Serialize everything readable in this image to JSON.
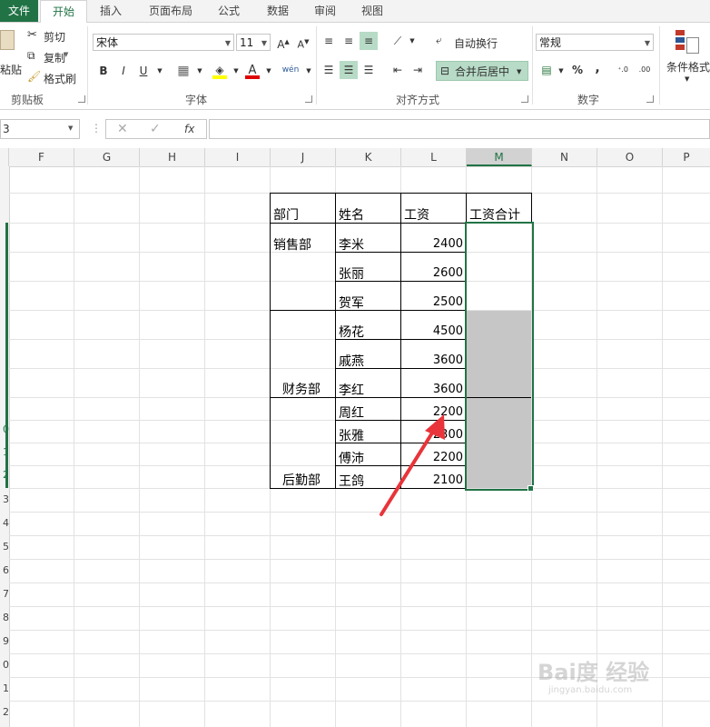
{
  "tabs": [
    "文件",
    "开始",
    "插入",
    "页面布局",
    "公式",
    "数据",
    "审阅",
    "视图"
  ],
  "clipboard": {
    "paste": "粘贴",
    "cut": "剪切",
    "copy": "复制",
    "format_painter": "格式刷",
    "group": "剪贴板"
  },
  "font": {
    "name": "宋体",
    "size": "11",
    "bold": "B",
    "italic": "I",
    "underline": "U",
    "group": "字体"
  },
  "alignment": {
    "wrap": "自动换行",
    "merge": "合并后居中",
    "group": "对齐方式"
  },
  "number": {
    "format": "常规",
    "percent": "%",
    "comma": ",",
    "group": "数字"
  },
  "styles": {
    "conditional": "条件格式"
  },
  "formula_bar": {
    "name_box": "3",
    "fx": "fx",
    "content": ""
  },
  "columns": [
    "F",
    "G",
    "H",
    "I",
    "J",
    "K",
    "L",
    "M",
    "N",
    "O",
    "P"
  ],
  "row_numbers": [
    "0",
    "1",
    "2",
    "3",
    "4",
    "5",
    "6",
    "7",
    "8",
    "9",
    "0",
    "1",
    "2"
  ],
  "table": {
    "headers": [
      "部门",
      "姓名",
      "工资",
      "工资合计"
    ],
    "departments": [
      "销售部",
      "财务部",
      "后勤部"
    ],
    "names": [
      "李米",
      "张丽",
      "贺军",
      "杨花",
      "戚燕",
      "李红",
      "周红",
      "张雅",
      "傅沛",
      "王鸽"
    ],
    "salaries": [
      "2400",
      "2600",
      "2500",
      "4500",
      "3600",
      "3600",
      "2200",
      "2300",
      "2200",
      "2100"
    ]
  },
  "watermark": {
    "brand": "Bai度 经验",
    "url": "jingyan.baidu.com"
  }
}
